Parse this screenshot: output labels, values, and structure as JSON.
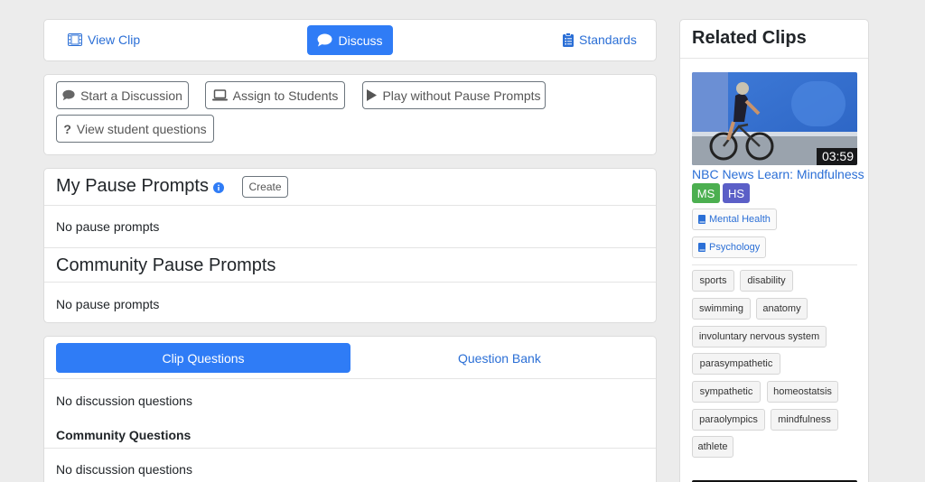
{
  "tabs": {
    "view_clip": "View Clip",
    "discuss": "Discuss",
    "standards": "Standards"
  },
  "actions": {
    "start_discussion": "Start a Discussion",
    "assign_students": "Assign to Students",
    "play_without_prompts": "Play without Pause Prompts",
    "view_student_questions": "View student questions"
  },
  "pause_prompts": {
    "my_title": "My Pause Prompts",
    "create_label": "Create",
    "my_empty": "No pause prompts",
    "community_title": "Community Pause Prompts",
    "community_empty": "No pause prompts"
  },
  "questions": {
    "tab_clip": "Clip Questions",
    "tab_bank": "Question Bank",
    "empty": "No discussion questions",
    "community_heading": "Community Questions",
    "community_empty": "No discussion questions"
  },
  "related": {
    "title": "Related Clips",
    "clip_duration": "03:59",
    "clip_title": "NBC News Learn: Mindfulness",
    "levels": [
      "MS",
      "HS"
    ],
    "subjects": [
      "Mental Health",
      "Psychology"
    ],
    "tags": [
      "sports",
      "disability",
      "swimming",
      "anatomy",
      "involuntary nervous system",
      "parasympathetic",
      "sympathetic",
      "homeostatsis",
      "paraolympics",
      "mindfulness",
      "athlete"
    ]
  },
  "colors": {
    "primary": "#2f7cf6",
    "link": "#2b6fd6",
    "level_ms": "#4caf50",
    "level_hs": "#5b5fc7"
  }
}
